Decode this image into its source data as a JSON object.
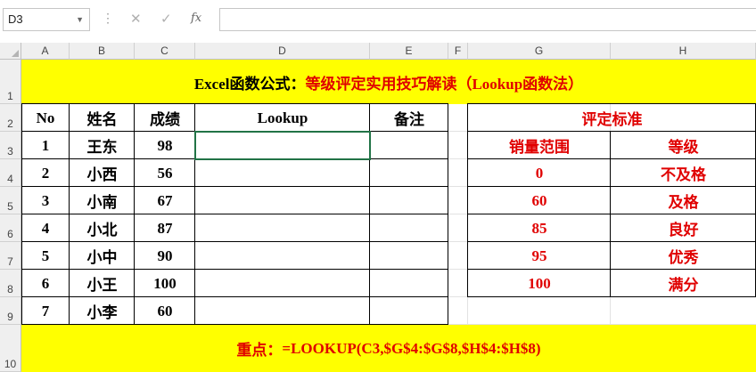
{
  "formula_bar": {
    "name_box": "D3",
    "cancel_icon": "✕",
    "enter_icon": "✓",
    "fx_label": "fx",
    "formula": ""
  },
  "columns": [
    "A",
    "B",
    "C",
    "D",
    "E",
    "F",
    "G",
    "H"
  ],
  "rows": [
    "1",
    "2",
    "3",
    "4",
    "5",
    "6",
    "7",
    "8",
    "9",
    "10"
  ],
  "title": {
    "prefix": "Excel函数公式：",
    "main": "等级评定实用技巧解读（Lookup函数法）"
  },
  "table": {
    "headers": [
      "No",
      "姓名",
      "成绩",
      "Lookup",
      "备注"
    ],
    "rows": [
      [
        "1",
        "王东",
        "98",
        "",
        ""
      ],
      [
        "2",
        "小西",
        "56",
        "",
        ""
      ],
      [
        "3",
        "小南",
        "67",
        "",
        ""
      ],
      [
        "4",
        "小北",
        "87",
        "",
        ""
      ],
      [
        "5",
        "小中",
        "90",
        "",
        ""
      ],
      [
        "6",
        "小王",
        "100",
        "",
        ""
      ],
      [
        "7",
        "小李",
        "60",
        "",
        ""
      ]
    ]
  },
  "criteria": {
    "title": "评定标准",
    "headers": [
      "销量范围",
      "等级"
    ],
    "rows": [
      [
        "0",
        "不及格"
      ],
      [
        "60",
        "及格"
      ],
      [
        "85",
        "良好"
      ],
      [
        "95",
        "优秀"
      ],
      [
        "100",
        "满分"
      ]
    ]
  },
  "footer": {
    "label": "重点：",
    "formula": "=LOOKUP(C3,$G$4:$G$8,$H$4:$H$8)"
  },
  "colors": {
    "highlight": "#ffff00",
    "accent_red": "#e00000",
    "selection": "#217346"
  }
}
